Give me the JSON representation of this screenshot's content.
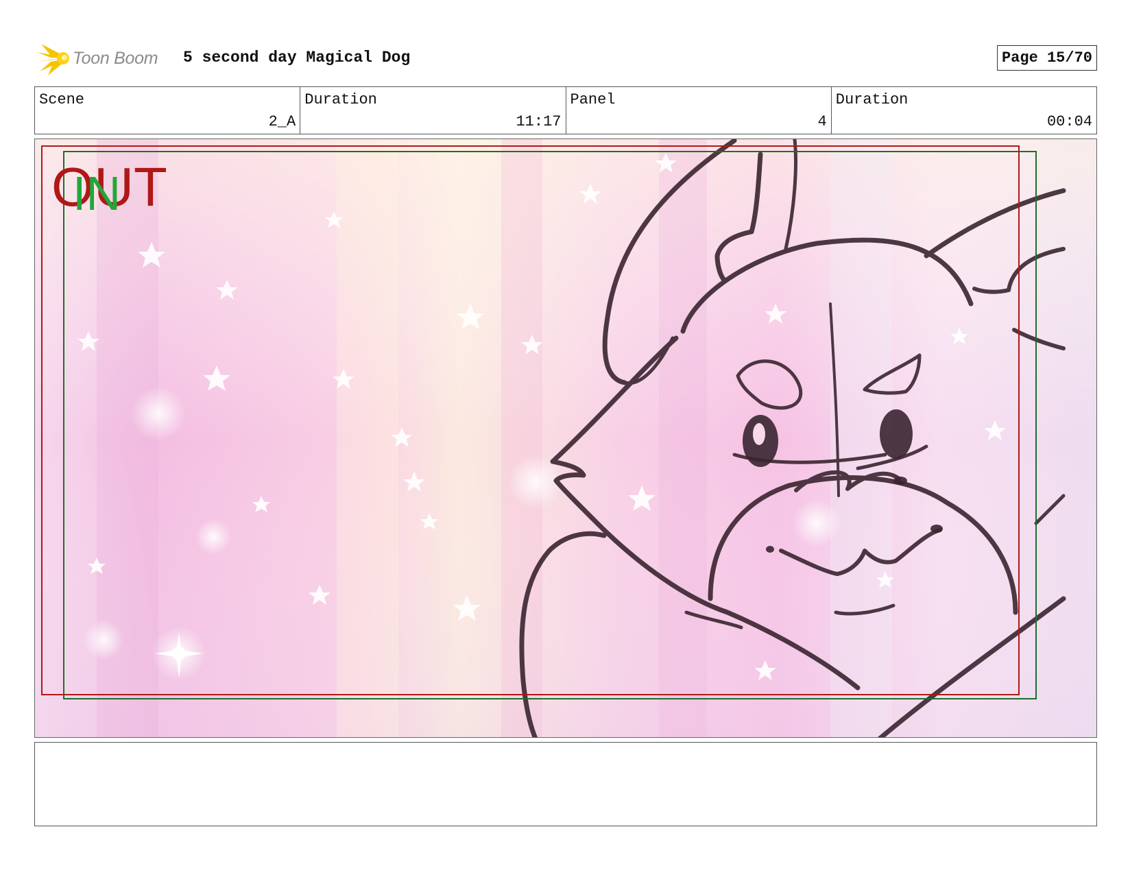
{
  "header": {
    "logo_text": "Toon Boom",
    "project_title": "5 second day Magical Dog",
    "page_label": "Page 15/70"
  },
  "info": [
    {
      "label": "Scene",
      "value": "2_A"
    },
    {
      "label": "Duration",
      "value": "11:17"
    },
    {
      "label": "Panel",
      "value": "4"
    },
    {
      "label": "Duration",
      "value": "00:04"
    }
  ],
  "panel": {
    "out_marker": "OUT",
    "in_marker": "IN",
    "colors": {
      "out_frame": "#b01818",
      "in_frame": "#1e6e2a",
      "sketch": "#3a2530"
    }
  },
  "notes": {
    "text": ""
  }
}
